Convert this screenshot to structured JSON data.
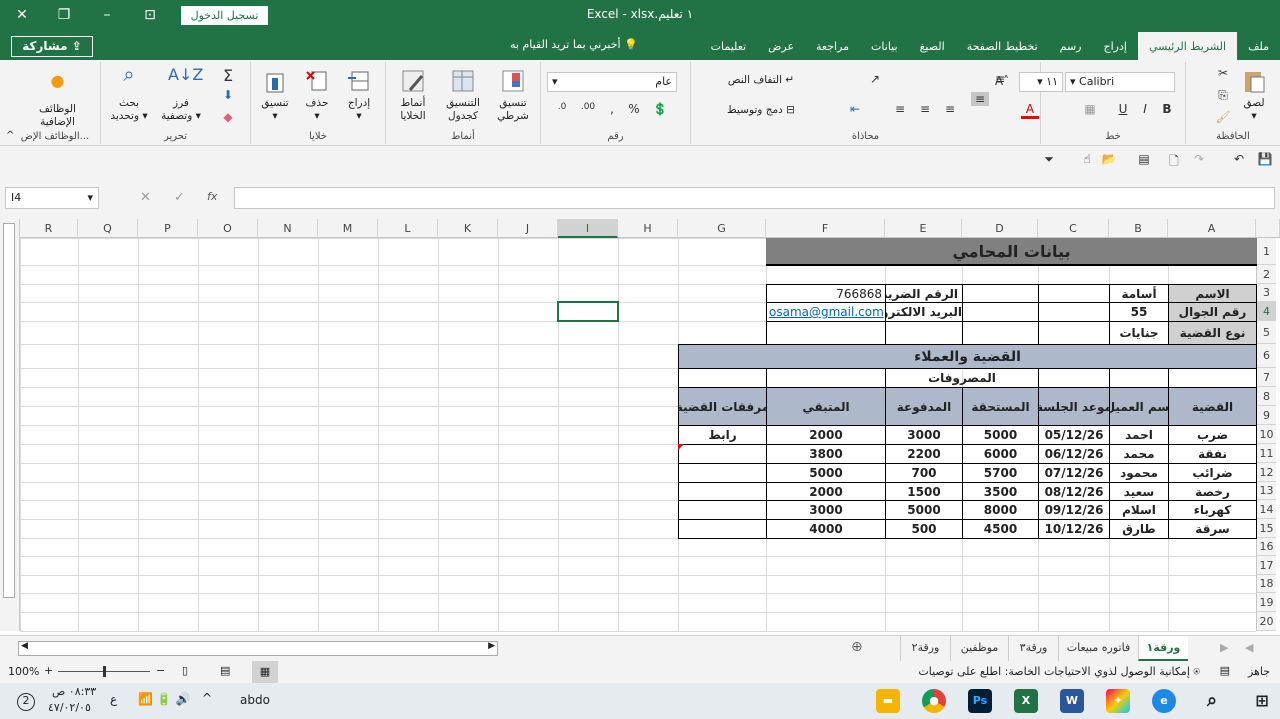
{
  "titlebar": {
    "title": "Excel  -  xlsx.١ تعليم",
    "login": "تسجيل الدخول"
  },
  "tabs": [
    "ملف",
    "الشريط الرئيسي",
    "إدراج",
    "رسم",
    "تخطيط الصفحة",
    "الصيغ",
    "بيانات",
    "مراجعة",
    "عرض",
    "تعليمات"
  ],
  "tell_me": "أخبرني بما تريد القيام به",
  "share": "مشاركة",
  "ribbon": {
    "clipboard": {
      "label": "الحافظة",
      "paste": "لصق"
    },
    "font": {
      "label": "خط",
      "name": "Calibri",
      "size": "١١",
      "bold": "B",
      "italic": "I",
      "underline": "U"
    },
    "alignment": {
      "label": "محاذاة",
      "wrap": "التفاف النص",
      "merge": "دمج وتوسيط"
    },
    "number": {
      "label": "رقم",
      "format": "عام",
      "percent": "%",
      "comma": ","
    },
    "styles": {
      "label": "أنماط",
      "conditional": "تنسيق شرطي",
      "table": "التنسيق كجدول",
      "cell": "أنماط الخلايا"
    },
    "cells": {
      "label": "خلايا",
      "insert": "إدراج",
      "delete": "حذف",
      "format": "تنسيق"
    },
    "editing": {
      "label": "تحرير",
      "sort": "فرز وتصفية",
      "find": "بحث وتحديد",
      "sum": "Σ"
    },
    "addins": {
      "label": "الوظائف الإض...",
      "btn": "الوظائف الإضافية"
    }
  },
  "formula_bar": {
    "name_box": "I4",
    "fx": "fx",
    "value": ""
  },
  "columns": [
    "A",
    "B",
    "C",
    "D",
    "E",
    "F",
    "G",
    "H",
    "I",
    "J",
    "K",
    "L",
    "M",
    "N",
    "O",
    "P",
    "Q",
    "R"
  ],
  "selected": {
    "col": "I",
    "row": 4
  },
  "sheet": {
    "title": "بيانات المحامي",
    "info": [
      {
        "label": "الاسم",
        "value": "أسامة"
      },
      {
        "label": "رقم الجوال",
        "value": "55"
      },
      {
        "label": "نوع القضية",
        "value": "جنايات"
      }
    ],
    "tax_label": "الرقم الضريبي",
    "tax_value": "766868",
    "email_label": "البريد الالكتروني",
    "email_value": "osama@gmail.com",
    "section_title": "القضية والعملاء",
    "expenses_label": "المصروفات",
    "headers": [
      "القضية",
      "اسم العميل",
      "موعد الجلسة",
      "المستحقة",
      "المدفوعة",
      "المتبقي",
      "مرفقات القضية"
    ],
    "rows": [
      [
        "ضرب",
        "احمد",
        "05/12/26",
        "5000",
        "3000",
        "2000",
        "رابط"
      ],
      [
        "نفقة",
        "محمد",
        "06/12/26",
        "6000",
        "2200",
        "3800",
        ""
      ],
      [
        "ضرائب",
        "محمود",
        "07/12/26",
        "5700",
        "700",
        "5000",
        ""
      ],
      [
        "رخصة",
        "سعيد",
        "08/12/26",
        "3500",
        "1500",
        "2000",
        ""
      ],
      [
        "كهرباء",
        "اسلام",
        "09/12/26",
        "8000",
        "5000",
        "3000",
        ""
      ],
      [
        "سرقة",
        "طارق",
        "10/12/26",
        "4500",
        "500",
        "4000",
        ""
      ]
    ]
  },
  "sheet_tabs": [
    "ورقة١",
    "فاتوره مبيعات",
    "ورقة٣",
    "موظفين",
    "ورقة٢"
  ],
  "status": {
    "ready": "جاهز",
    "accessibility": "إمكانية الوصول لذوي الاحتياجات الخاصة: اطلع على توصيات",
    "zoom": "100%"
  },
  "taskbar": {
    "user": "abdo",
    "time": "٠٨:٣٣ ص",
    "date": "٤٧/٠٢/٠٥",
    "lang": "ع",
    "notif": "2"
  },
  "colors": {
    "green": "#217346",
    "title_fill": "#808080",
    "section_fill": "#adb9ca",
    "label_fill": "#d0d0d0"
  }
}
